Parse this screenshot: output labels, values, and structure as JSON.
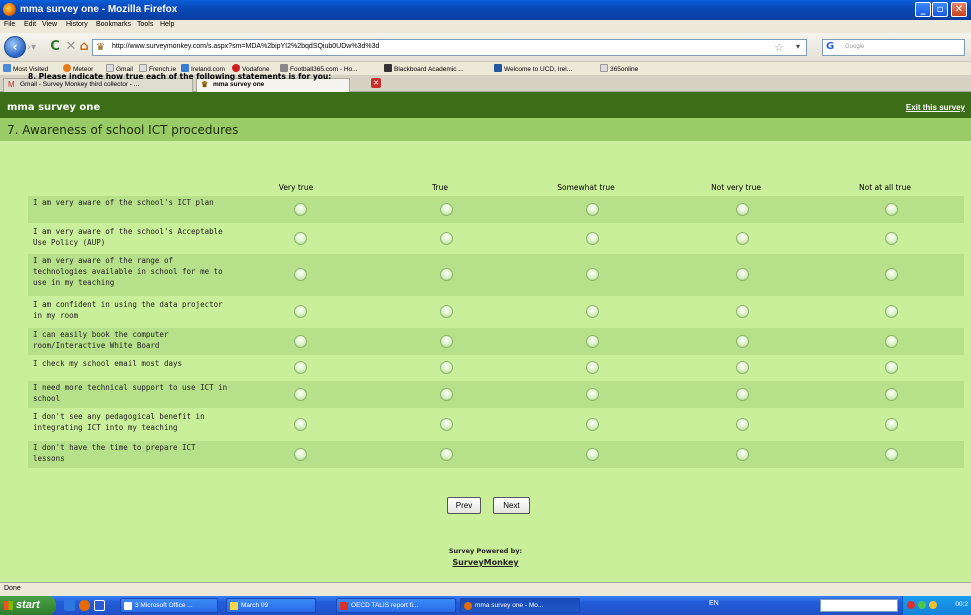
{
  "window": {
    "title": "mma survey one - Mozilla Firefox"
  },
  "menu": [
    "File",
    "Edit",
    "View",
    "History",
    "Bookmarks",
    "Tools",
    "Help"
  ],
  "nav": {
    "url": "http://www.surveymonkey.com/s.aspx?sm=MDA%2bipYI2%2bqdSQiub0UDw%3d%3d",
    "search_placeholder": "Google"
  },
  "bookmarks": [
    "Most Visited",
    "Meteor",
    "Gmail",
    "French.ie",
    "Ireland.com",
    "Vodafone",
    "Football365.com - Ho...",
    "Blackboard Academic ...",
    "Welcome to UCD, Irel...",
    "365online"
  ],
  "tabs": [
    {
      "label": "Gmail - Survey Monkey third collector - ...",
      "active": false
    },
    {
      "label": "mma survey one",
      "active": true
    }
  ],
  "survey": {
    "title": "mma survey one",
    "exit_label": "Exit this survey",
    "section": "7. Awareness of school ICT procedures",
    "question": "8. Please indicate how true each of the following statements is for you:",
    "columns": [
      "Very true",
      "True",
      "Somewhat true",
      "Not very true",
      "Not at all true"
    ],
    "statements": [
      "I am very aware of the school's ICT plan",
      "I am very aware of the school's Acceptable Use Policy (AUP)",
      "I am very aware of the range of technologies available in school for me to use in my teaching",
      "I am confident in using the data projector in my room",
      "I can easily book the computer room/Interactive White Board",
      "I check my school email most days",
      "I need more technical support to use ICT in school",
      "I don't see any pedagogical benefit in integrating ICT into my teaching",
      "I don't have the time to prepare ICT lessons"
    ],
    "prev_label": "Prev",
    "next_label": "Next",
    "powered_by": "Survey Powered by:",
    "provider": "SurveyMonkey"
  },
  "status": "Done",
  "taskbar": {
    "start": "start",
    "tasks": [
      "3 Microsoft Office ...",
      "March 09",
      "OECD TALIS report fi...",
      "mma survey one - Mo..."
    ],
    "lang": "EN",
    "clock": "00:2"
  }
}
